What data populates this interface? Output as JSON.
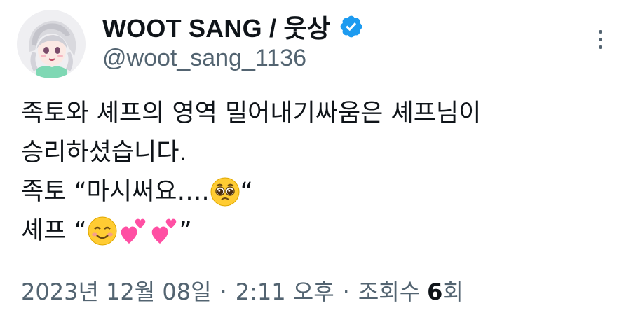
{
  "user": {
    "display_name": "WOOT SANG / 웃상",
    "handle": "@woot_sang_1136",
    "verified": true,
    "verified_color": "#1d9bf0"
  },
  "tweet": {
    "lines": [
      "족토와 셰프의 영역 밀어내기싸움은 셰프님이",
      "승리하셨습니다.",
      "족토 “마시써요….",
      "셰프 “"
    ],
    "line3_end": "“",
    "line4_end": "”",
    "line3_emojis": [
      "pleading-face"
    ],
    "line4_emojis": [
      "smiling-face",
      "two-hearts",
      "two-hearts"
    ]
  },
  "meta": {
    "date": "2023년 12월 08일",
    "separator": "·",
    "time": "2:11 오후",
    "views_label_prefix": "조회수",
    "views_count": "6",
    "views_label_suffix": "회"
  },
  "colors": {
    "text": "#0f1419",
    "secondary": "#536471"
  },
  "icons": {
    "verified": "verified-badge-icon",
    "more": "more-options-icon"
  }
}
